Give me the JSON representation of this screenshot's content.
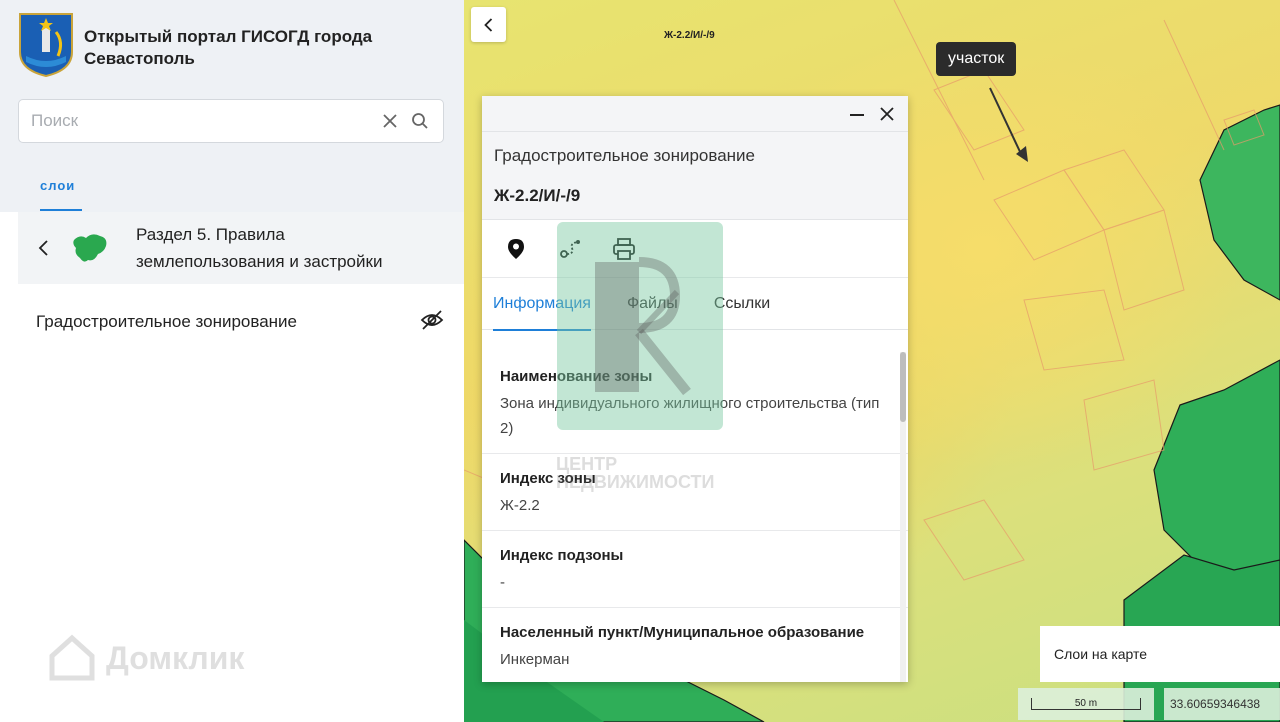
{
  "portal": {
    "title": "Открытый портал ГИСОГД города Севастополь"
  },
  "search": {
    "placeholder": "Поиск",
    "value": ""
  },
  "sidebar": {
    "tab_label": "слои",
    "section_label": "Раздел 5. Правила землепользования и застройки",
    "layer_label": "Градостроительное зонирование"
  },
  "map": {
    "zone_label": "Ж-2.2/И/-/9",
    "tooltip": "участок",
    "layers_button": "Слои на карте",
    "scale_label": "50 m",
    "coords": "33.60659346438"
  },
  "panel": {
    "subtitle": "Градостроительное зонирование",
    "title": "Ж-2.2/И/-/9",
    "tabs": [
      "Информация",
      "Файлы",
      "Ссылки"
    ],
    "properties": [
      {
        "key": "Наименование зоны",
        "value": "Зона индивидуального жилищного строительства (тип 2)"
      },
      {
        "key": "Индекс зоны",
        "value": "Ж-2.2"
      },
      {
        "key": "Индекс подзоны",
        "value": "-"
      },
      {
        "key": "Населенный пункт/Муниципальное образование",
        "value": "Инкерман"
      }
    ]
  },
  "watermarks": {
    "logo_text": "ЦЕНТР НЕДВИЖИМОСТИ",
    "brand": "Домклик"
  },
  "colors": {
    "accent": "#1e7fd8",
    "map_green": "#2fae58",
    "map_yellow": "#f1d55c"
  }
}
